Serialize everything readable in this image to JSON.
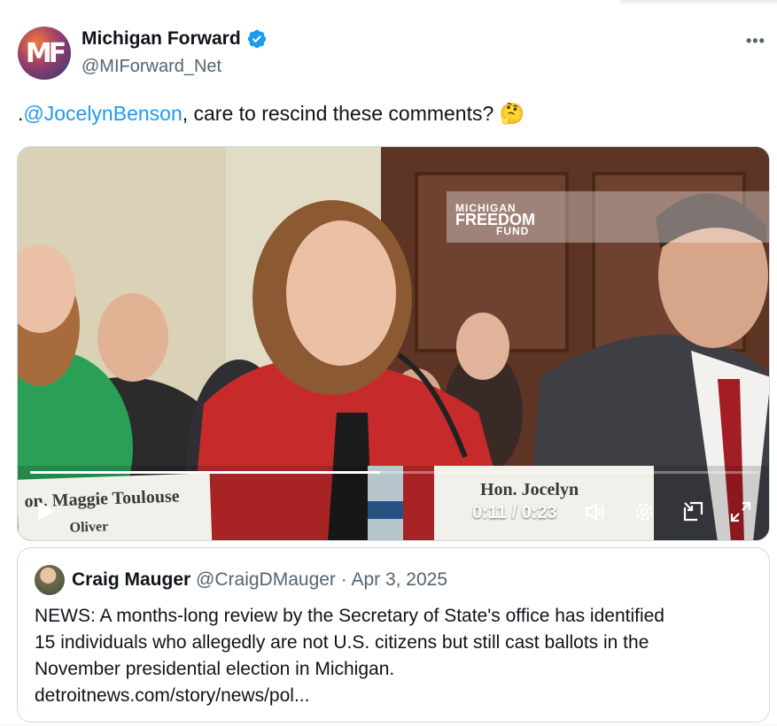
{
  "author": {
    "display_name": "Michigan Forward",
    "handle": "@MIForward_Net",
    "avatar_initials": "MF",
    "verified": true
  },
  "tweet": {
    "prefix": ".",
    "mention": "@JocelynBenson",
    "text": ", care to rescind these comments? 🤔"
  },
  "video": {
    "time": "0:11 / 0:23",
    "progress": 0.48,
    "watermark_top": "MICHIGAN",
    "watermark_mid": "FREEDOM",
    "watermark_bottom": "FUND",
    "nameplate_left_line1": "on. Maggie Toulouse",
    "nameplate_left_line2": "Oliver",
    "nameplate_right_line1": "Hon. Jocelyn"
  },
  "quote": {
    "name": "Craig Mauger",
    "handle": "@CraigDMauger",
    "separator": " · ",
    "date": "Apr 3, 2025",
    "lines": [
      "NEWS: A months-long review by the Secretary of State's office has identified",
      "15 individuals who allegedly are not U.S. citizens but still cast ballots in the",
      "November presidential election in Michigan.",
      "detroitnews.com/story/news/pol..."
    ]
  },
  "colors": {
    "link": "#1d9bf0",
    "verified": "#1d9bf0",
    "secondary_text": "#536471"
  },
  "icons": [
    "verified-badge-icon",
    "more-icon",
    "play-icon",
    "volume-icon",
    "settings-gear-icon",
    "picture-in-picture-icon",
    "fullscreen-icon"
  ]
}
